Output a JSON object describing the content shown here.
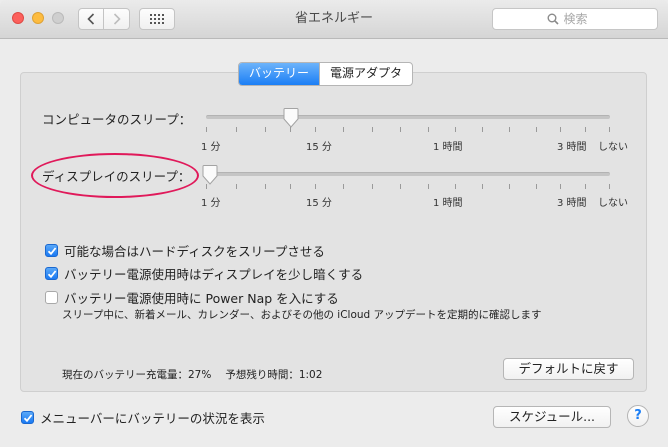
{
  "window": {
    "title": "省エネルギー"
  },
  "toolbar": {
    "search_placeholder": "検索"
  },
  "tabs": [
    {
      "label": "バッテリー",
      "active": true
    },
    {
      "label": "電源アダプタ",
      "active": false
    }
  ],
  "computer_sleep": {
    "label": "コンピュータのスリープ：",
    "value_label": "15 分",
    "position": 0.21
  },
  "display_sleep": {
    "label": "ディスプレイのスリープ：",
    "value_label": "1 分",
    "position": 0.0
  },
  "slider_scale": {
    "labels": [
      "1 分",
      "15 分",
      "1 時間",
      "3 時間",
      "しない"
    ]
  },
  "options": [
    {
      "label": "可能な場合はハードディスクをスリープさせる",
      "checked": true
    },
    {
      "label": "バッテリー電源使用時はディスプレイを少し暗くする",
      "checked": true
    },
    {
      "label": "バッテリー電源使用時に Power Nap を入にする",
      "checked": false
    }
  ],
  "power_nap_note": "スリープ中に、新着メール、カレンダー、およびその他の iCloud アップデートを定期的に確認します",
  "battery_status": {
    "charge_label": "現在のバッテリー充電量：",
    "charge": "27%",
    "remaining_label": "予想残り時間：",
    "remaining": "1:02"
  },
  "buttons": {
    "restore_defaults": "デフォルトに戻す",
    "schedule": "スケジュール...",
    "help": "?"
  },
  "menubar_option": {
    "label": "メニューバーにバッテリーの状況を表示",
    "checked": true
  },
  "colors": {
    "accent": "#1b7ef5",
    "highlight_ring": "#e0195a"
  }
}
